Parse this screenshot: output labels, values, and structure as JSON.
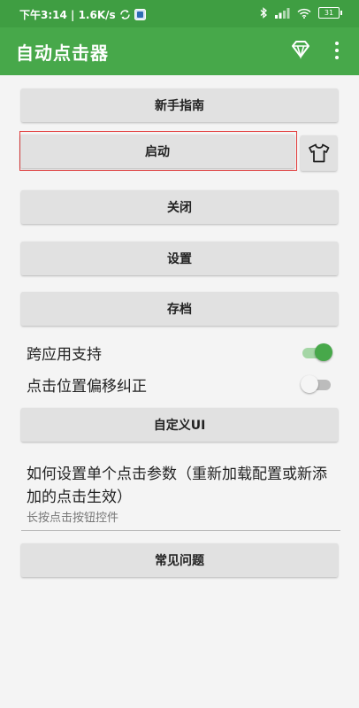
{
  "status_bar": {
    "time_speed": "下午3:14 | 1.6K/s",
    "battery": "31"
  },
  "app_bar": {
    "title": "自动点击器",
    "icons": [
      "diamond-icon",
      "more-vert-icon"
    ]
  },
  "buttons": {
    "guide": "新手指南",
    "start": "启动",
    "close": "关闭",
    "settings": "设置",
    "archive": "存档",
    "custom_ui": "自定义UI",
    "faq": "常见问题"
  },
  "toggles": [
    {
      "label": "跨应用支持",
      "on": true
    },
    {
      "label": "点击位置偏移纠正",
      "on": false
    }
  ],
  "click_params": {
    "title": "如何设置单个点击参数（重新加载配置或新添加的点击生效）",
    "subtitle": "长按点击按钮控件"
  },
  "colors": {
    "accent": "#47a84a",
    "status_bar": "#3f9e42",
    "highlight_border": "#e23b3b"
  }
}
